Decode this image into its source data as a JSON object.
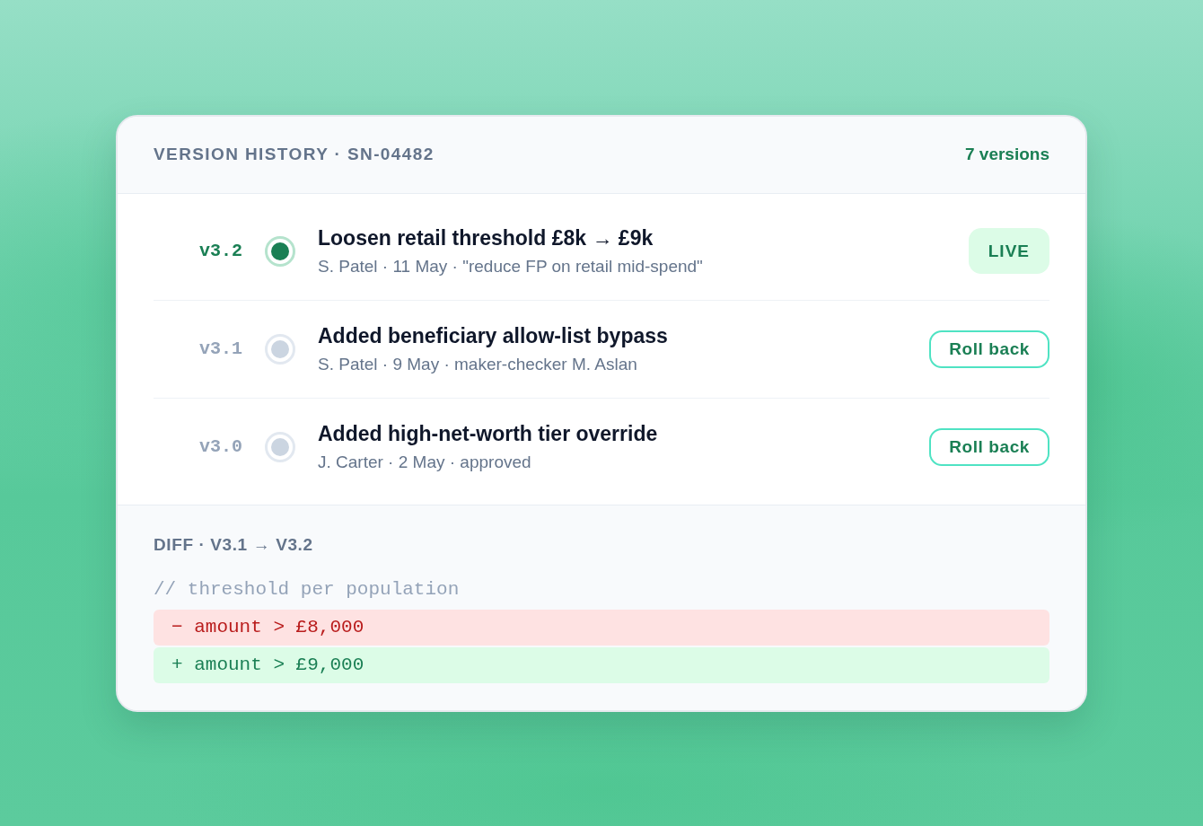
{
  "header": {
    "title": "VERSION HISTORY · SN-04482",
    "count": "7 versions"
  },
  "versions": [
    {
      "version": "v3.2",
      "selected": true,
      "title": "Loosen retail threshold £8k → £9k",
      "meta": "S. Patel · 11 May · \"reduce FP on retail mid-spend\"",
      "action": {
        "kind": "badge",
        "label": "LIVE"
      }
    },
    {
      "version": "v3.1",
      "selected": false,
      "title": "Added beneficiary allow-list bypass",
      "meta": "S. Patel · 9 May · maker-checker M. Aslan",
      "action": {
        "kind": "button",
        "label": "Roll back"
      }
    },
    {
      "version": "v3.0",
      "selected": false,
      "title": "Added high-net-worth tier override",
      "meta": "J. Carter · 2 May · approved",
      "action": {
        "kind": "button",
        "label": "Roll back"
      }
    }
  ],
  "diff": {
    "title": "DIFF · V3.1 → V3.2",
    "lines": [
      {
        "kind": "comment",
        "text": "// threshold per population"
      },
      {
        "kind": "removed",
        "text": "− amount > £8,000"
      },
      {
        "kind": "added",
        "text": "+ amount > £9,000"
      }
    ]
  }
}
